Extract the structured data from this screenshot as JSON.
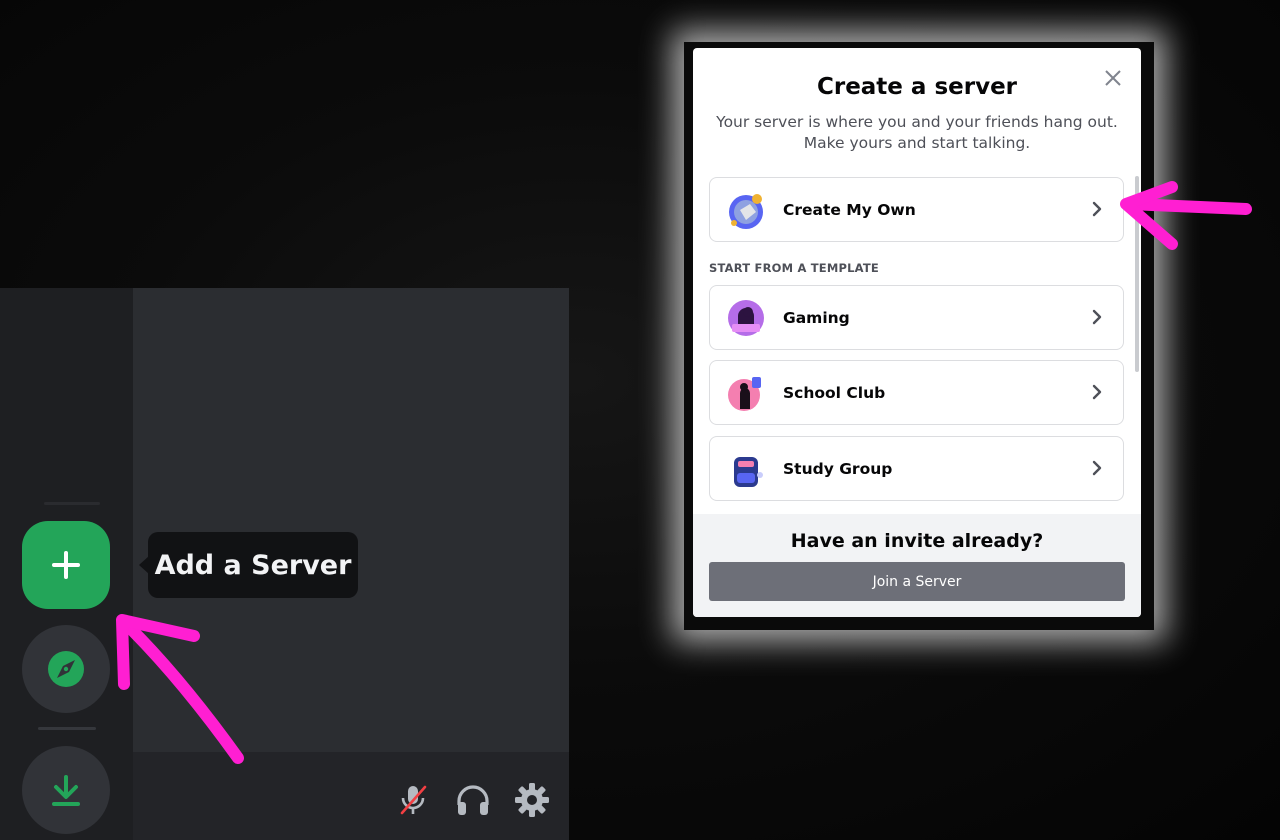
{
  "tooltip": {
    "text": "Add a Server"
  },
  "modal": {
    "title": "Create a server",
    "description": "Your server is where you and your friends hang out. Make yours and start talking.",
    "create_option": "Create My Own",
    "section_label": "START FROM A TEMPLATE",
    "templates": [
      {
        "label": "Gaming"
      },
      {
        "label": "School Club"
      },
      {
        "label": "Study Group"
      }
    ],
    "footer_title": "Have an invite already?",
    "join_button": "Join a Server"
  },
  "colors": {
    "accent_green": "#23a559",
    "annotation_magenta": "#ff1fd2",
    "join_button": "#6d6f78"
  },
  "icons": {
    "add": "plus-icon",
    "explore": "compass-icon",
    "download": "download-icon",
    "mute": "microphone-muted-icon",
    "headset": "headphones-icon",
    "settings": "gear-icon",
    "close": "close-icon",
    "chevron": "chevron-right-icon"
  }
}
